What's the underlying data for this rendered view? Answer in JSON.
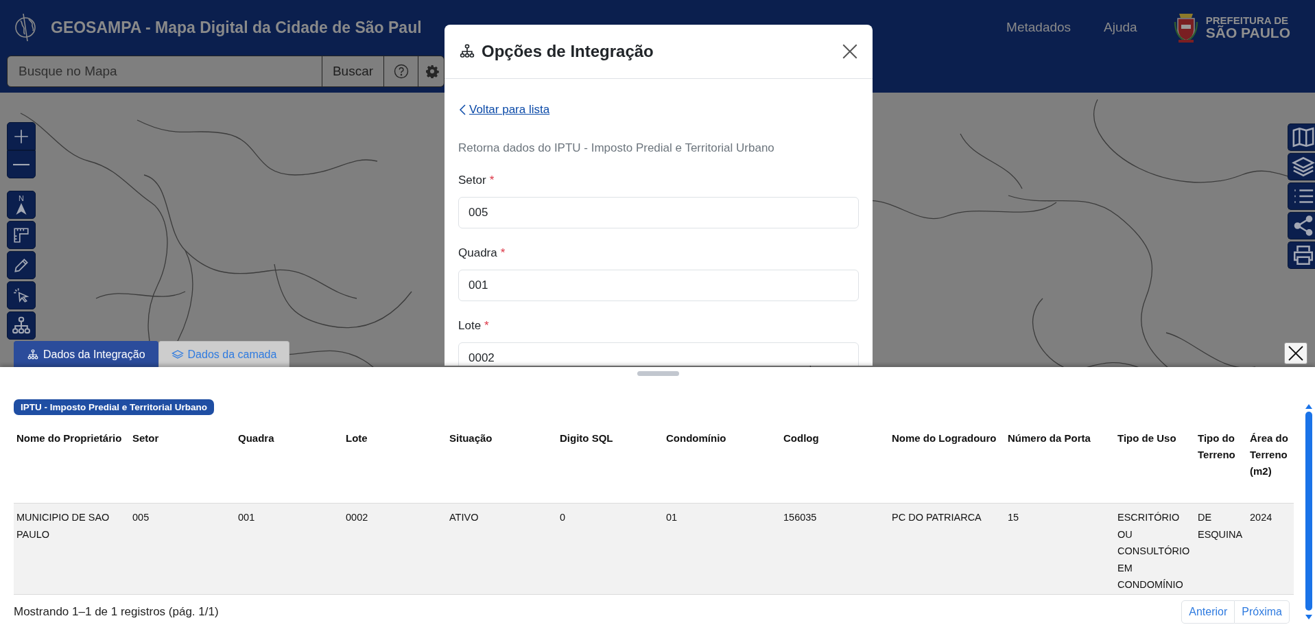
{
  "header": {
    "title": "GEOSAMPA - Mapa Digital da Cidade de São Paul",
    "links": [
      "Metadados",
      "Ajuda"
    ],
    "logo": {
      "line_1": "PREFEITURA DE",
      "line_2": "SÃO PAULO"
    }
  },
  "search": {
    "placeholder": "Busque no Mapa",
    "button": "Buscar"
  },
  "map_tools": {
    "north_label": "N"
  },
  "modal": {
    "title": "Opções de Integração",
    "back_link": "Voltar para lista",
    "description": "Retorna dados do IPTU - Imposto Predial e Territorial Urbano",
    "fields": [
      {
        "label": "Setor",
        "required_mark": "*",
        "value": "005"
      },
      {
        "label": "Quadra",
        "required_mark": "*",
        "value": "001"
      },
      {
        "label": "Lote",
        "required_mark": "*",
        "value": "0002"
      }
    ]
  },
  "bottom_panel": {
    "tabs": [
      {
        "label": "Dados da Integração",
        "selected": true
      },
      {
        "label": "Dados da camada",
        "selected": false
      }
    ],
    "badge": "IPTU - Imposto Predial e Territorial Urbano",
    "table": {
      "columns": [
        "Nome do Proprietário",
        "Setor",
        "Quadra",
        "Lote",
        "Situação",
        "Digito SQL",
        "Condomínio",
        "Codlog",
        "Nome do Logradouro",
        "Número da Porta",
        "Tipo de Uso",
        "Tipo do Terreno",
        "Área do Terreno (m2)"
      ],
      "rows": [
        [
          "MUNICIPIO DE SAO PAULO",
          "005",
          "001",
          "0002",
          "ATIVO",
          "0",
          "01",
          "156035",
          "PC DO PATRIARCA",
          "15",
          "ESCRITÓRIO OU CONSULTÓRIO EM CONDOMÍNIO",
          "DE ESQUINA",
          "2024"
        ]
      ]
    },
    "footer": "Mostrando 1–1 de 1 registros (pág. 1/1)",
    "pagination": [
      "Anterior",
      "Próxima"
    ]
  }
}
